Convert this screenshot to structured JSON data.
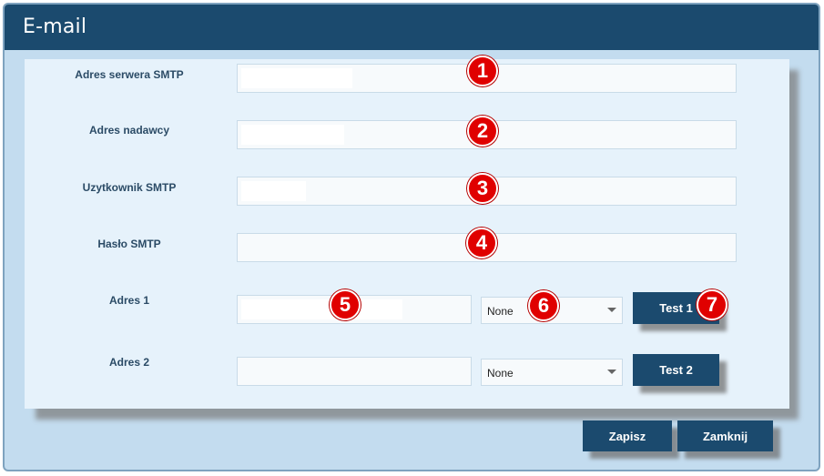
{
  "dialog": {
    "title": "E-mail"
  },
  "fields": {
    "smtp_server": {
      "label": "Adres serwera SMTP",
      "value": ""
    },
    "sender": {
      "label": "Adres nadawcy",
      "value": ""
    },
    "smtp_user": {
      "label": "Uzytkownik SMTP",
      "value": ""
    },
    "smtp_password": {
      "label": "Hasło SMTP",
      "value": ""
    },
    "address1": {
      "label": "Adres 1",
      "value": "",
      "select_value": "None",
      "test_label": "Test 1"
    },
    "address2": {
      "label": "Adres 2",
      "value": "",
      "select_value": "None",
      "test_label": "Test 2"
    }
  },
  "footer": {
    "save_label": "Zapisz",
    "close_label": "Zamknij"
  },
  "markers": [
    "1",
    "2",
    "3",
    "4",
    "5",
    "6",
    "7"
  ],
  "colors": {
    "header": "#1b4a6e",
    "dialog_bg": "#c3dcef",
    "panel_bg": "#e6f2fb",
    "button": "#1b4a6e",
    "marker": "#e00000"
  }
}
